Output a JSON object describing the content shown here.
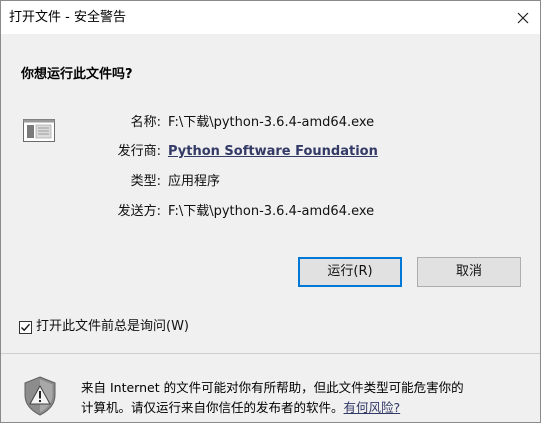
{
  "window": {
    "title": "打开文件 - 安全警告"
  },
  "question": "你想运行此文件吗?",
  "file_info": {
    "name_label": "名称:",
    "name_value": "F:\\下载\\python-3.6.4-amd64.exe",
    "publisher_label": "发行商:",
    "publisher_value": "Python Software Foundation",
    "type_label": "类型:",
    "type_value": "应用程序",
    "from_label": "发送方:",
    "from_value": "F:\\下载\\python-3.6.4-amd64.exe"
  },
  "buttons": {
    "run_label": "运行(R)",
    "cancel_label": "取消"
  },
  "checkbox": {
    "label": "打开此文件前总是询问(W)",
    "checked": true
  },
  "warning": {
    "line1": "来自 Internet 的文件可能对你有所帮助，但此文件类型可能危害你的",
    "line2": "计算机。请仅运行来自你信任的发布者的软件。",
    "link": "有何风险?"
  },
  "colors": {
    "accent": "#0078d7",
    "link": "#333a66"
  }
}
